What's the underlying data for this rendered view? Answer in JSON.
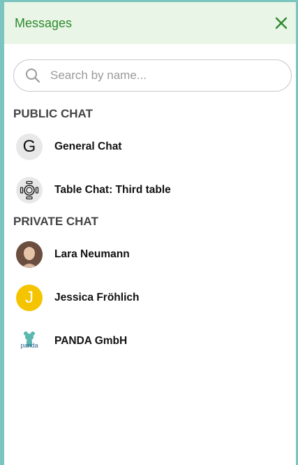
{
  "header": {
    "title": "Messages",
    "accent_color": "#2e8b2e",
    "close_icon": "close-icon"
  },
  "search": {
    "placeholder": "Search by name...",
    "value": ""
  },
  "public_section": {
    "title": "PUBLIC CHAT",
    "items": [
      {
        "label": "General Chat",
        "avatar": "G"
      },
      {
        "label": "Table Chat: Third table",
        "avatar": "table-icon"
      }
    ]
  },
  "private_section": {
    "title": "PRIVATE CHAT",
    "items": [
      {
        "label": "Lara Neumann",
        "avatar": "photo"
      },
      {
        "label": "Jessica Fröhlich",
        "avatar": "J",
        "avatar_color": "#f5c400"
      },
      {
        "label": "PANDA GmbH",
        "avatar": "panda-logo",
        "logo_text": "panda"
      }
    ]
  }
}
